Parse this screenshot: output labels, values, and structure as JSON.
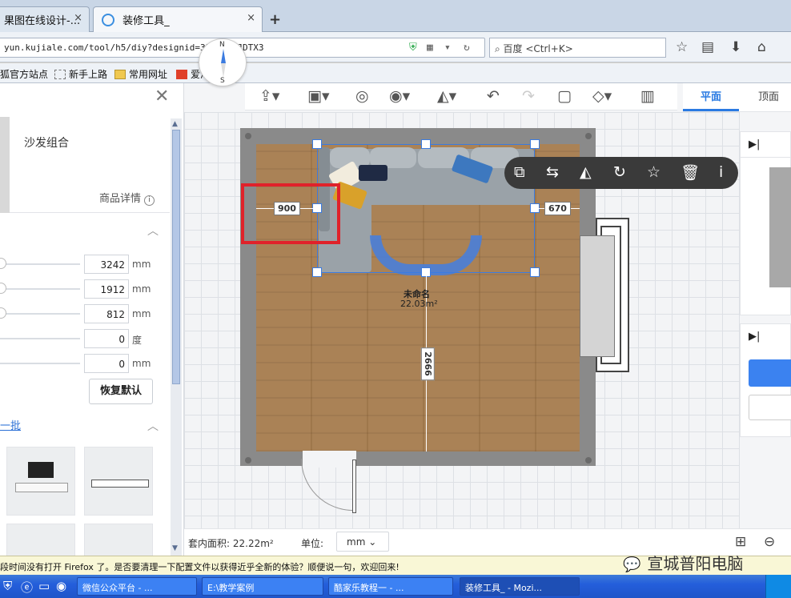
{
  "browser": {
    "tabs": [
      {
        "label": "果图在线设计-...",
        "active": false
      },
      {
        "label": "装修工具_",
        "active": true
      }
    ],
    "new_tab": "+",
    "url": "yun.kujiale.com/tool/h5/diy?designid=3F04LUUJDTX3",
    "search_placeholder": "百度 <Ctrl+K>",
    "bookmarks": [
      "狐官方站点",
      "新手上路",
      "常用网址",
      "爱淘宝"
    ]
  },
  "toolbar": {
    "icons": [
      "upload-icon",
      "toolbox-icon",
      "shape-icon",
      "eye-icon",
      "mirror-icon",
      "undo-icon",
      "redo-icon",
      "save-icon",
      "eraser-icon",
      "map-icon"
    ],
    "view_tabs": [
      {
        "label": "平面",
        "active": true
      },
      {
        "label": "顶面",
        "active": false
      }
    ]
  },
  "left_panel": {
    "product_name": "沙发组合",
    "detail_link": "商品详情",
    "sliders": [
      {
        "value": "3242",
        "unit": "mm",
        "level": 0
      },
      {
        "value": "1912",
        "unit": "mm",
        "level": 0
      },
      {
        "value": "812",
        "unit": "mm",
        "level": 0
      },
      {
        "value": "0",
        "unit": "度",
        "level": 0
      },
      {
        "value": "0",
        "unit": "mm",
        "level": 0
      }
    ],
    "reset_button": "恢复默认",
    "batch_link": "一批"
  },
  "canvas": {
    "compass": {
      "north": "N",
      "south": "S"
    },
    "dimensions": {
      "left": "900",
      "right": "670",
      "bottom": "2666"
    },
    "room": {
      "name": "未命名",
      "area": "22.03m²"
    },
    "context_actions": [
      "copy-icon",
      "swap-icon",
      "flip-icon",
      "rotate-icon",
      "star-icon",
      "delete-icon",
      "info-icon"
    ]
  },
  "statusbar": {
    "area_label": "套内面积: 22.22m²",
    "unit_label": "单位:",
    "unit_value": "mm"
  },
  "notification": "段时间没有打开 Firefox 了。是否要清理一下配置文件以获得近乎全新的体验？顺便说一句，欢迎回来!",
  "watermark": "宣城普阳电脑",
  "taskbar": {
    "items": [
      {
        "label": "微信公众平台 - ...",
        "active": false
      },
      {
        "label": "E:\\教学案例",
        "active": false
      },
      {
        "label": "酷家乐教程一 - ...",
        "active": false
      },
      {
        "label": "装修工具_ - Mozi...",
        "active": true
      }
    ]
  },
  "colors": {
    "accent": "#2a7ae2",
    "highlight": "#e0222a",
    "selection": "#3b7be0"
  }
}
